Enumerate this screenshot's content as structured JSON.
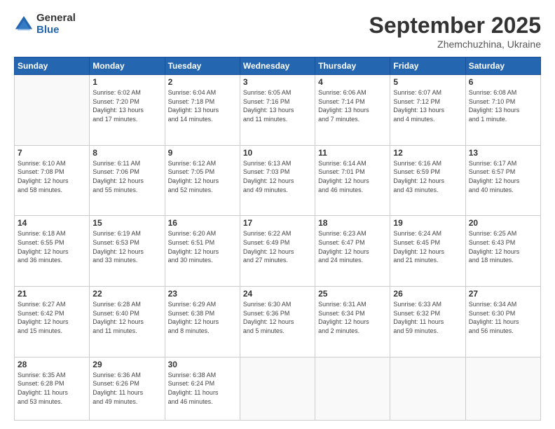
{
  "logo": {
    "general": "General",
    "blue": "Blue"
  },
  "header": {
    "month": "September 2025",
    "location": "Zhemchuzhina, Ukraine"
  },
  "weekdays": [
    "Sunday",
    "Monday",
    "Tuesday",
    "Wednesday",
    "Thursday",
    "Friday",
    "Saturday"
  ],
  "days": [
    {
      "date": "",
      "info": ""
    },
    {
      "date": "1",
      "info": "Sunrise: 6:02 AM\nSunset: 7:20 PM\nDaylight: 13 hours\nand 17 minutes."
    },
    {
      "date": "2",
      "info": "Sunrise: 6:04 AM\nSunset: 7:18 PM\nDaylight: 13 hours\nand 14 minutes."
    },
    {
      "date": "3",
      "info": "Sunrise: 6:05 AM\nSunset: 7:16 PM\nDaylight: 13 hours\nand 11 minutes."
    },
    {
      "date": "4",
      "info": "Sunrise: 6:06 AM\nSunset: 7:14 PM\nDaylight: 13 hours\nand 7 minutes."
    },
    {
      "date": "5",
      "info": "Sunrise: 6:07 AM\nSunset: 7:12 PM\nDaylight: 13 hours\nand 4 minutes."
    },
    {
      "date": "6",
      "info": "Sunrise: 6:08 AM\nSunset: 7:10 PM\nDaylight: 13 hours\nand 1 minute."
    },
    {
      "date": "7",
      "info": ""
    },
    {
      "date": "8",
      "info": "Sunrise: 6:11 AM\nSunset: 7:06 PM\nDaylight: 12 hours\nand 55 minutes."
    },
    {
      "date": "9",
      "info": "Sunrise: 6:12 AM\nSunset: 7:05 PM\nDaylight: 12 hours\nand 52 minutes."
    },
    {
      "date": "10",
      "info": "Sunrise: 6:13 AM\nSunset: 7:03 PM\nDaylight: 12 hours\nand 49 minutes."
    },
    {
      "date": "11",
      "info": "Sunrise: 6:14 AM\nSunset: 7:01 PM\nDaylight: 12 hours\nand 46 minutes."
    },
    {
      "date": "12",
      "info": "Sunrise: 6:16 AM\nSunset: 6:59 PM\nDaylight: 12 hours\nand 43 minutes."
    },
    {
      "date": "13",
      "info": "Sunrise: 6:17 AM\nSunset: 6:57 PM\nDaylight: 12 hours\nand 40 minutes."
    },
    {
      "date": "14",
      "info": ""
    },
    {
      "date": "15",
      "info": "Sunrise: 6:19 AM\nSunset: 6:53 PM\nDaylight: 12 hours\nand 33 minutes."
    },
    {
      "date": "16",
      "info": "Sunrise: 6:20 AM\nSunset: 6:51 PM\nDaylight: 12 hours\nand 30 minutes."
    },
    {
      "date": "17",
      "info": "Sunrise: 6:22 AM\nSunset: 6:49 PM\nDaylight: 12 hours\nand 27 minutes."
    },
    {
      "date": "18",
      "info": "Sunrise: 6:23 AM\nSunset: 6:47 PM\nDaylight: 12 hours\nand 24 minutes."
    },
    {
      "date": "19",
      "info": "Sunrise: 6:24 AM\nSunset: 6:45 PM\nDaylight: 12 hours\nand 21 minutes."
    },
    {
      "date": "20",
      "info": "Sunrise: 6:25 AM\nSunset: 6:43 PM\nDaylight: 12 hours\nand 18 minutes."
    },
    {
      "date": "21",
      "info": ""
    },
    {
      "date": "22",
      "info": "Sunrise: 6:28 AM\nSunset: 6:40 PM\nDaylight: 12 hours\nand 11 minutes."
    },
    {
      "date": "23",
      "info": "Sunrise: 6:29 AM\nSunset: 6:38 PM\nDaylight: 12 hours\nand 8 minutes."
    },
    {
      "date": "24",
      "info": "Sunrise: 6:30 AM\nSunset: 6:36 PM\nDaylight: 12 hours\nand 5 minutes."
    },
    {
      "date": "25",
      "info": "Sunrise: 6:31 AM\nSunset: 6:34 PM\nDaylight: 12 hours\nand 2 minutes."
    },
    {
      "date": "26",
      "info": "Sunrise: 6:33 AM\nSunset: 6:32 PM\nDaylight: 11 hours\nand 59 minutes."
    },
    {
      "date": "27",
      "info": "Sunrise: 6:34 AM\nSunset: 6:30 PM\nDaylight: 11 hours\nand 56 minutes."
    },
    {
      "date": "28",
      "info": ""
    },
    {
      "date": "29",
      "info": "Sunrise: 6:36 AM\nSunset: 6:26 PM\nDaylight: 11 hours\nand 49 minutes."
    },
    {
      "date": "30",
      "info": "Sunrise: 6:38 AM\nSunset: 6:24 PM\nDaylight: 11 hours\nand 46 minutes."
    },
    {
      "date": "",
      "info": ""
    },
    {
      "date": "",
      "info": ""
    },
    {
      "date": "",
      "info": ""
    },
    {
      "date": "",
      "info": ""
    }
  ],
  "day7": {
    "info": "Sunrise: 6:10 AM\nSunset: 7:08 PM\nDaylight: 12 hours\nand 58 minutes."
  },
  "day14": {
    "info": "Sunrise: 6:18 AM\nSunset: 6:55 PM\nDaylight: 12 hours\nand 36 minutes."
  },
  "day21": {
    "info": "Sunrise: 6:27 AM\nSunset: 6:42 PM\nDaylight: 12 hours\nand 15 minutes."
  },
  "day28": {
    "info": "Sunrise: 6:35 AM\nSunset: 6:28 PM\nDaylight: 11 hours\nand 53 minutes."
  }
}
